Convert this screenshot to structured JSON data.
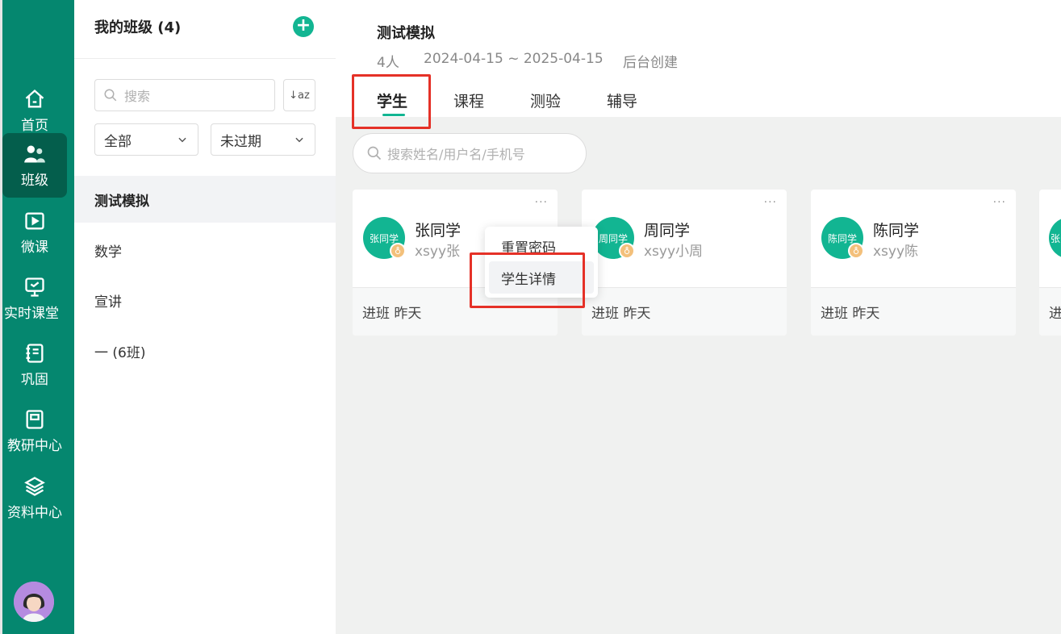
{
  "nav": {
    "items": [
      {
        "label": "首页",
        "icon": "home-icon"
      },
      {
        "label": "班级",
        "icon": "users-icon",
        "active": true
      },
      {
        "label": "微课",
        "icon": "play-icon"
      },
      {
        "label": "实时课堂",
        "icon": "classroom-icon"
      },
      {
        "label": "巩固",
        "icon": "notebook-icon"
      },
      {
        "label": "教研中心",
        "icon": "book-icon"
      },
      {
        "label": "资料中心",
        "icon": "layers-icon"
      }
    ]
  },
  "panel": {
    "title": "我的班级 (4)",
    "add_label": "+",
    "search_placeholder": "搜索",
    "sort_label": "↓az",
    "filter_scope": "全部",
    "filter_status": "未过期",
    "classes": [
      "测试模拟",
      "数学",
      "宣讲",
      "一 (6班)"
    ]
  },
  "header": {
    "class_name": "测试模拟",
    "count": "4人",
    "date_range": "2024-04-15 ~ 2025-04-15",
    "created_by": "后台创建",
    "tabs": [
      "学生",
      "课程",
      "测验",
      "辅导"
    ]
  },
  "student_search_placeholder": "搜索姓名/用户名/手机号",
  "students": [
    {
      "name": "张同学",
      "username": "xsyy张",
      "avatar_text": "张同学",
      "joined": "进班  昨天"
    },
    {
      "name": "周同学",
      "username": "xsyy小周",
      "avatar_text": "周同学",
      "joined": "进班  昨天"
    },
    {
      "name": "陈同学",
      "username": "xsyy陈",
      "avatar_text": "陈同学",
      "joined": "进班  昨天"
    },
    {
      "name": "",
      "username": "",
      "avatar_text": "张",
      "joined": "进"
    }
  ],
  "more_label": "···",
  "badge_label": "♁",
  "context_menu": [
    "重置密码",
    "学生详情"
  ],
  "colors": {
    "nav_bg": "#05876f",
    "nav_active": "#045e4c",
    "accent": "#12b592",
    "highlight_box": "#e53127"
  }
}
